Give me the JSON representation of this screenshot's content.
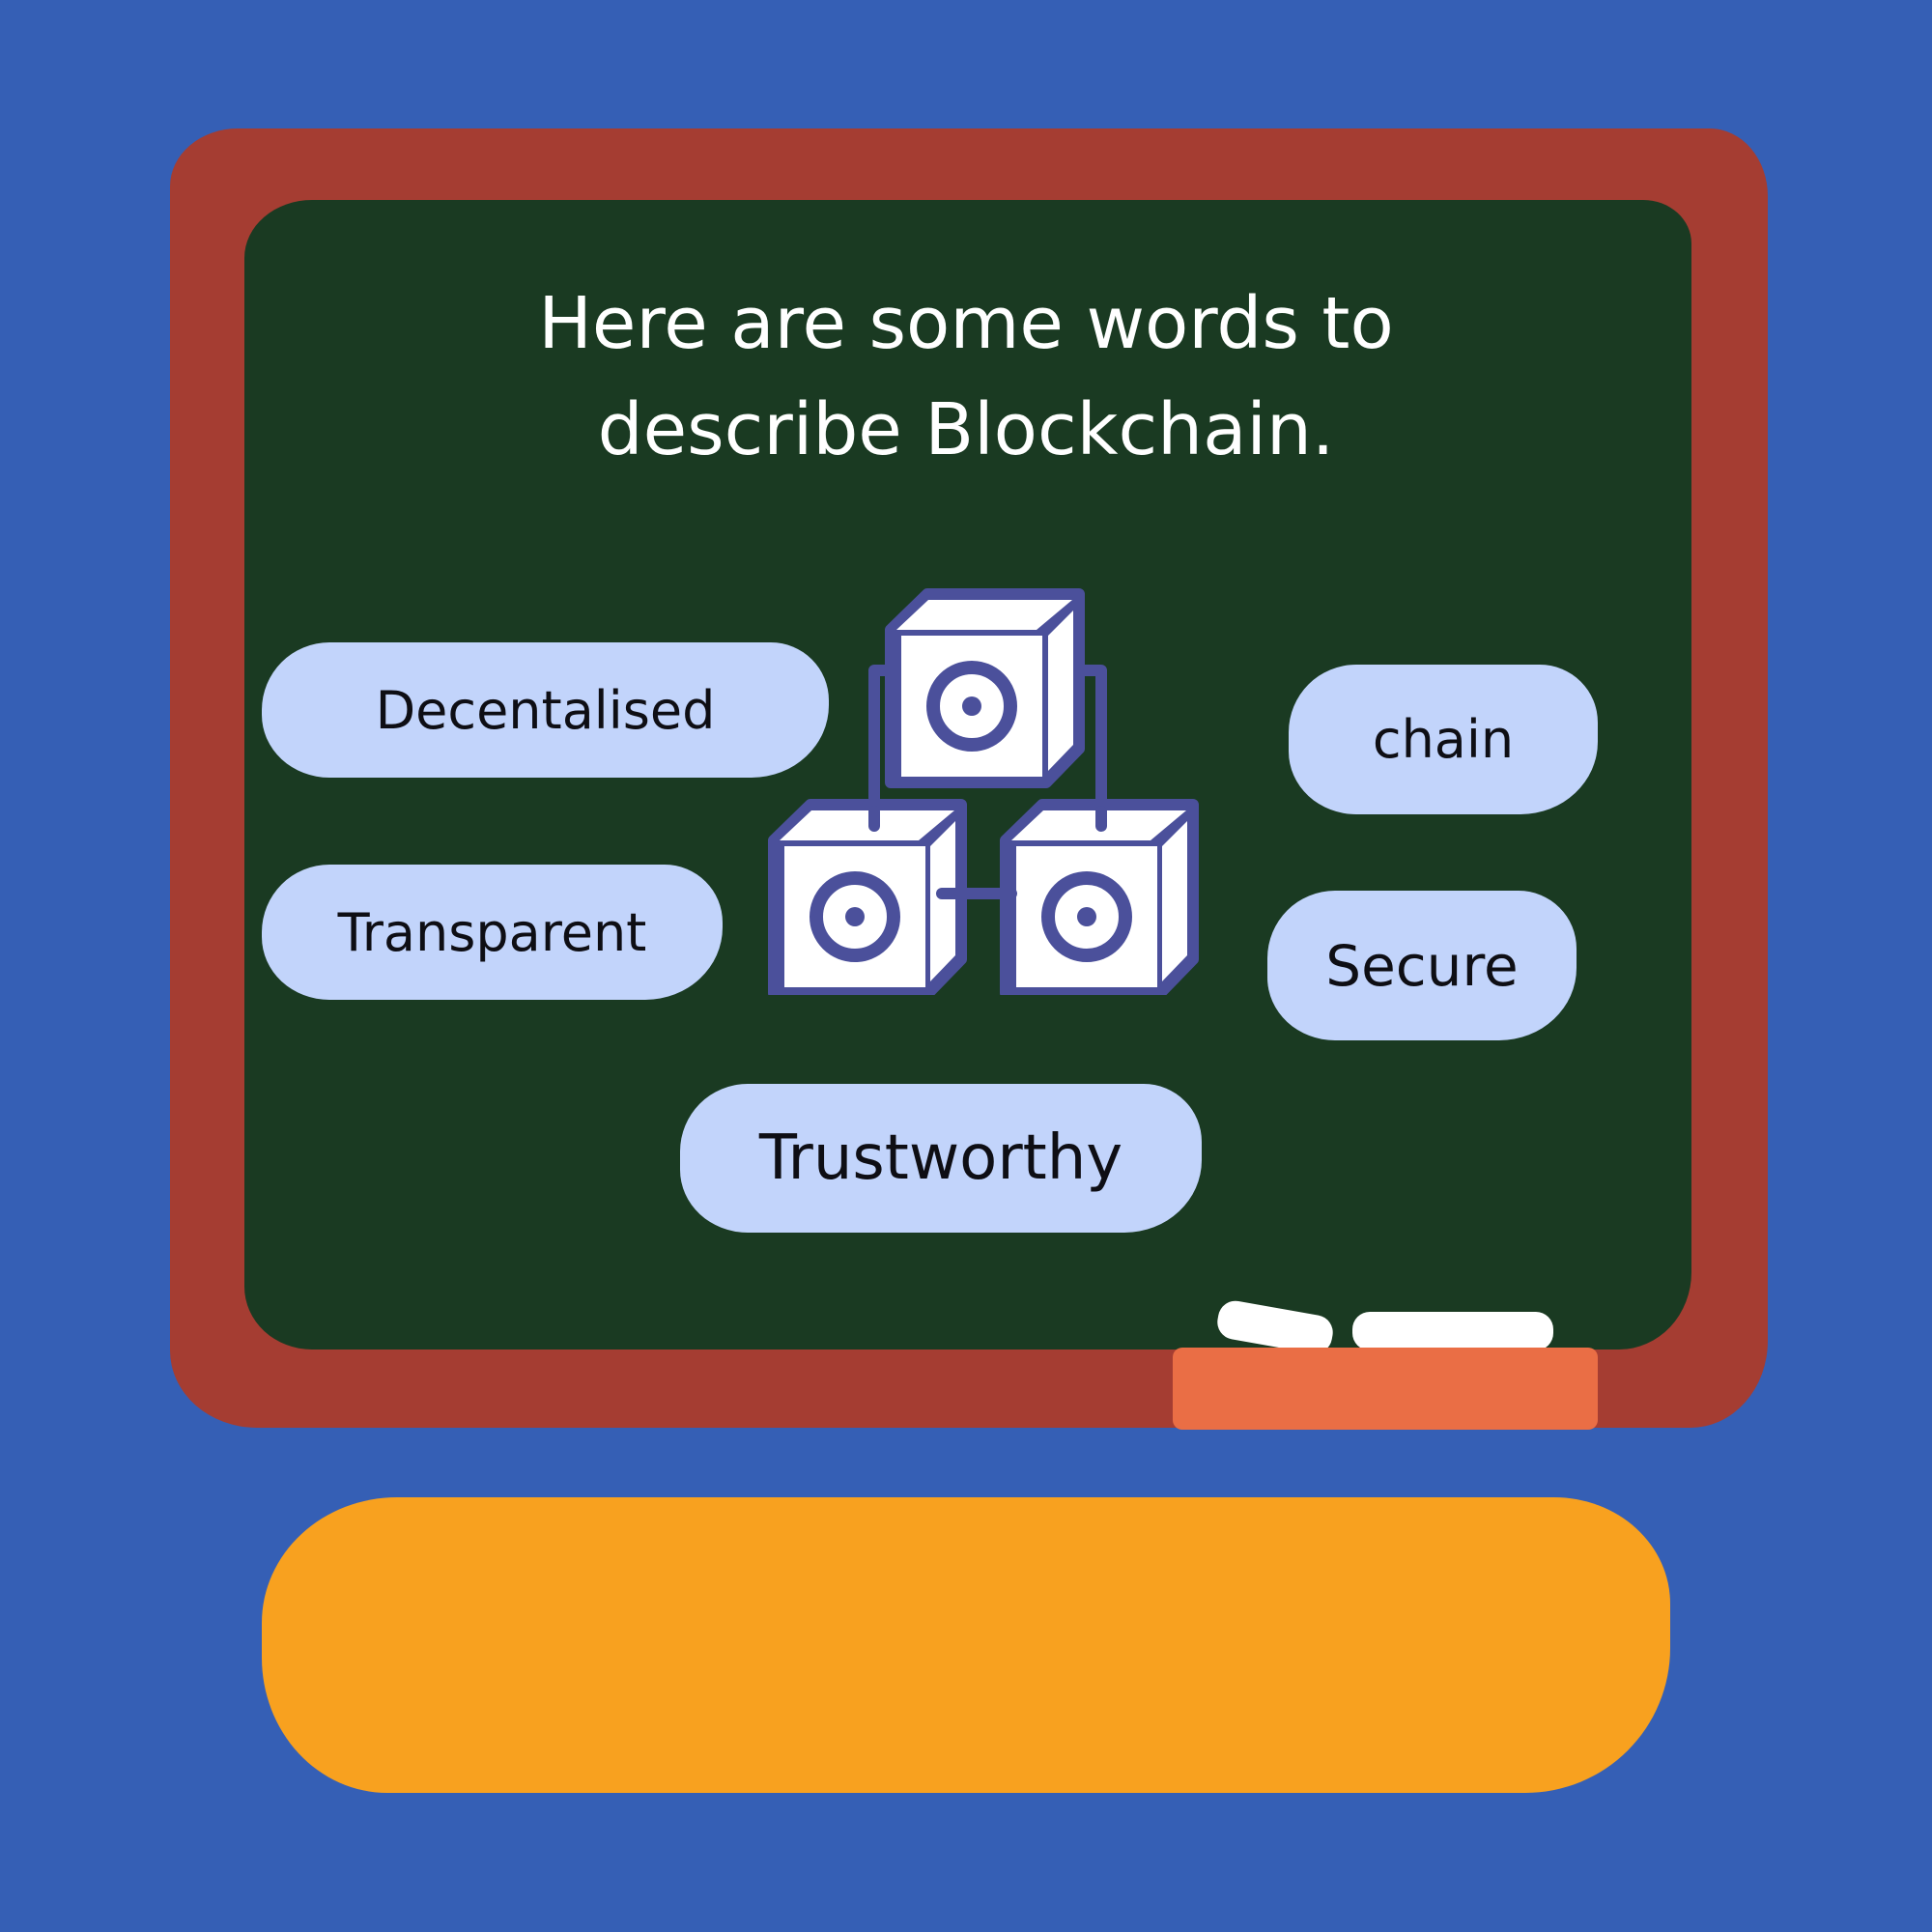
{
  "title": "Here are some words to describe Blockchain.",
  "words": {
    "decentralised": "Decentalised",
    "transparent": "Transparent",
    "trustworthy": "Trustworthy",
    "chain": "chain",
    "secure": "Secure"
  },
  "icons": {
    "center": "blockchain-blocks-icon"
  },
  "colors": {
    "background": "#355fb5",
    "board_frame": "#a53d32",
    "board_surface": "#1a3a22",
    "pill": "#c2d4fb",
    "icon_stroke": "#4b509b",
    "chalk_tray": "#ea6e45",
    "desk": "#f8a11f"
  }
}
